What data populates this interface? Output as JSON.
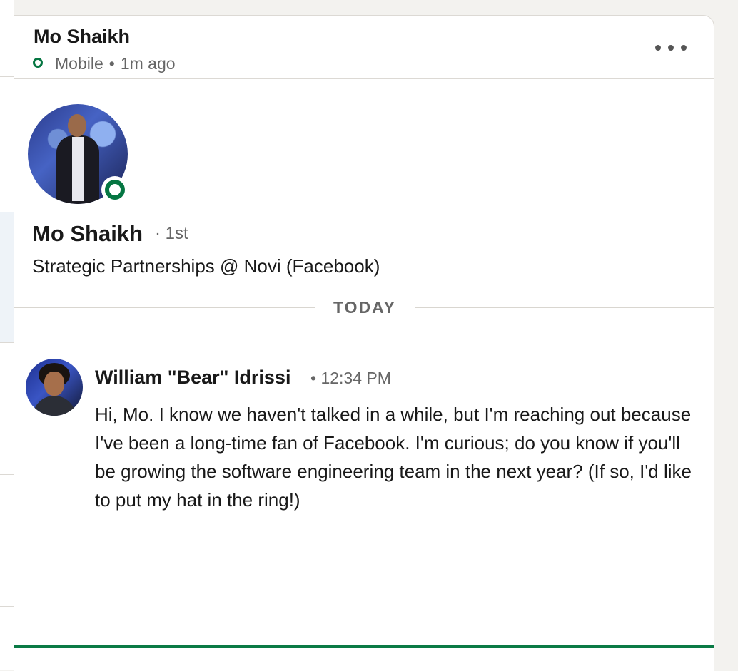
{
  "header": {
    "name": "Mo Shaikh",
    "device": "Mobile",
    "separator": "•",
    "last_active": "1m ago"
  },
  "profile": {
    "name": "Mo Shaikh",
    "degree": "· 1st",
    "headline": "Strategic Partnerships @ Novi (Facebook)"
  },
  "divider": {
    "label": "TODAY"
  },
  "messages": [
    {
      "sender": "William \"Bear\" Idrissi",
      "time": "• 12:34 PM",
      "text": "Hi, Mo. I know we haven't talked in a while, but I'm reaching out because I've been a long-time fan of Facebook. I'm curious; do you know if you'll be growing the software engineering team in the next year? (If so, I'd like to put my hat in the ring!)"
    }
  ],
  "compose": {
    "placeholder": ""
  },
  "colors": {
    "presence": "#057642",
    "compose_focus": "#0a7a45"
  },
  "icons": {
    "more": "more-horizontal-icon",
    "presence": "online-status-icon"
  }
}
